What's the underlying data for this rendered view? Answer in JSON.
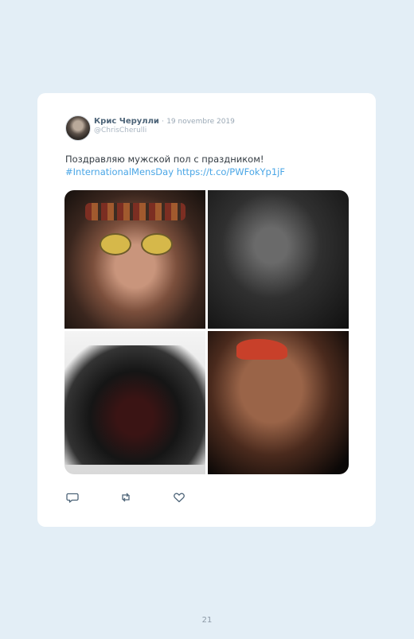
{
  "tweet": {
    "author_name": "Крис Черулли",
    "separator": "·",
    "date": "19 novembre 2019",
    "handle": "@ChrisCherulli",
    "text_plain": "Поздравляю мужской пол с праздником!",
    "hashtag": "#InternationalMensDay",
    "link": "https://t.co/PWFokYp1jF",
    "photos": [
      "photo-1",
      "photo-2",
      "photo-3",
      "photo-4"
    ],
    "actions": {
      "reply_icon": "speech-bubble-icon",
      "retweet_icon": "retweet-arrows-icon",
      "like_icon": "heart-icon"
    }
  },
  "page_number": "21",
  "colors": {
    "background": "#e3eef6",
    "card": "#ffffff",
    "link": "#4aa6e6",
    "icon": "#4d6478"
  }
}
